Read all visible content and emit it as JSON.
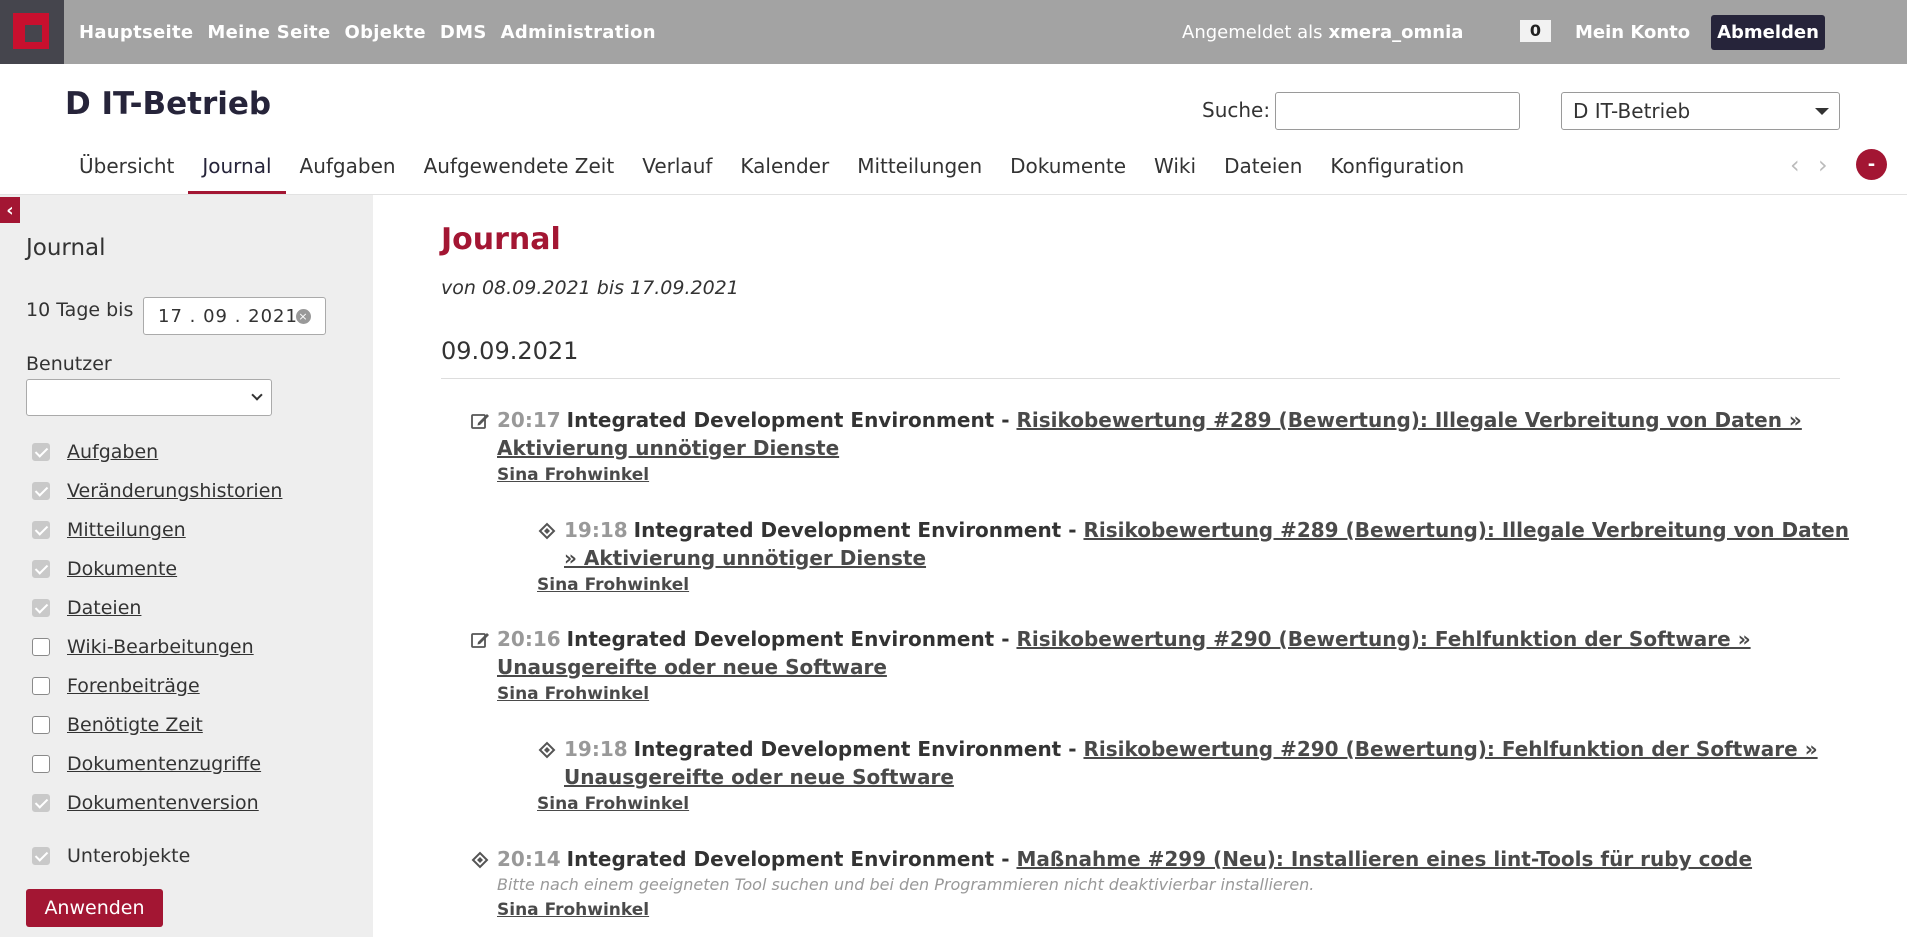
{
  "topbar": {
    "nav": [
      "Hauptseite",
      "Meine Seite",
      "Objekte",
      "DMS",
      "Administration"
    ],
    "logged_in_prefix": "Angemeldet als",
    "username": "xmera_omnia",
    "notification_count": "0",
    "my_account": "Mein Konto",
    "logout": "Abmelden"
  },
  "header": {
    "project_title": "D IT-Betrieb",
    "search_label": "Suche:",
    "search_value": "",
    "project_select": "D IT-Betrieb"
  },
  "tabs": [
    "Übersicht",
    "Journal",
    "Aufgaben",
    "Aufgewendete Zeit",
    "Verlauf",
    "Kalender",
    "Mitteilungen",
    "Dokumente",
    "Wiki",
    "Dateien",
    "Konfiguration"
  ],
  "active_tab": "Journal",
  "tab_controls": {
    "prev": "‹",
    "next": "›",
    "more": "-"
  },
  "sidebar": {
    "toggle": "‹",
    "heading": "Journal",
    "days_label": "10 Tage bis",
    "date_value": "17 . 09 . 2021",
    "user_label": "Benutzer",
    "user_value": "",
    "filters": [
      {
        "label": "Aufgaben",
        "checked": true
      },
      {
        "label": "Veränderungshistorien",
        "checked": true
      },
      {
        "label": "Mitteilungen",
        "checked": true
      },
      {
        "label": "Dokumente",
        "checked": true
      },
      {
        "label": "Dateien",
        "checked": true
      },
      {
        "label": "Wiki-Bearbeitungen",
        "checked": false
      },
      {
        "label": "Forenbeiträge",
        "checked": false
      },
      {
        "label": "Benötigte Zeit",
        "checked": false
      },
      {
        "label": "Dokumentenzugriffe",
        "checked": false
      },
      {
        "label": "Dokumentenversion",
        "checked": true
      }
    ],
    "subprojects": {
      "label": "Unterobjekte",
      "checked": true
    },
    "apply": "Anwenden"
  },
  "main": {
    "title": "Journal",
    "range": "von 08.09.2021 bis 17.09.2021",
    "day": "09.09.2021",
    "entries": [
      {
        "icon": "edit-icon",
        "time": "20:17",
        "project": "Integrated Development Environment - ",
        "link_line1": "Risikobewertung #289 (Bewertung): Illegale Verbreitung von Daten »",
        "link_line2": "Aktivierung unnötiger Dienste",
        "author": "Sina Frohwinkel"
      },
      {
        "icon": "ticket-icon",
        "time": "19:18",
        "project": "Integrated Development Environment - ",
        "link_line1": "Risikobewertung #289 (Bewertung): Illegale Verbreitung von Daten",
        "link_line2": "» Aktivierung unnötiger Dienste",
        "author": "Sina Frohwinkel"
      },
      {
        "icon": "edit-icon",
        "time": "20:16",
        "project": "Integrated Development Environment - ",
        "link_line1": "Risikobewertung #290 (Bewertung): Fehlfunktion der Software »",
        "link_line2": "Unausgereifte oder neue Software",
        "author": "Sina Frohwinkel"
      },
      {
        "icon": "ticket-icon",
        "time": "19:18",
        "project": "Integrated Development Environment - ",
        "link_line1": "Risikobewertung #290 (Bewertung): Fehlfunktion der Software »",
        "link_line2": "Unausgereifte oder neue Software",
        "author": "Sina Frohwinkel"
      },
      {
        "icon": "ticket-icon",
        "time": "20:14",
        "project": "Integrated Development Environment - ",
        "link_line1": "Maßnahme #299 (Neu): Installieren eines lint-Tools für ruby code",
        "description": "Bitte nach einem geeigneten Tool suchen und bei den Programmieren nicht deaktivierbar installieren.",
        "author": "Sina Frohwinkel"
      }
    ]
  },
  "colors": {
    "topbar": "#a3a3a3",
    "accent": "#a31633",
    "dark": "#26243a",
    "sidebar": "#eeeeee"
  }
}
